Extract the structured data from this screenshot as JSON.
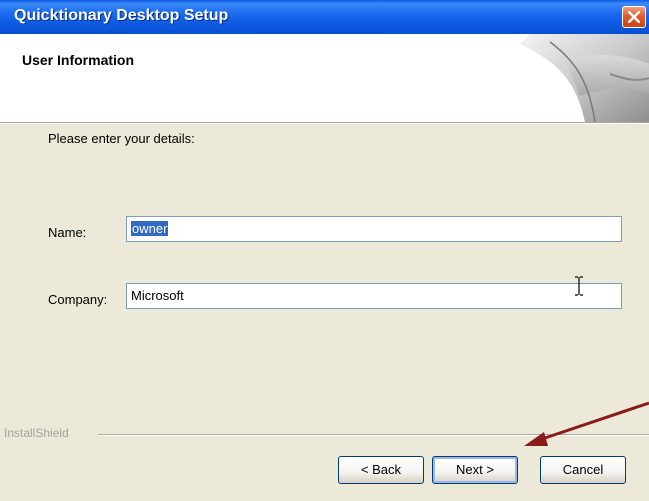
{
  "window": {
    "title": "Quicktionary Desktop Setup"
  },
  "header": {
    "title": "User Information"
  },
  "form": {
    "prompt": "Please enter your details:",
    "name_label": "Name:",
    "name_value": "owner",
    "company_label": "Company:",
    "company_value": "Microsoft"
  },
  "footer": {
    "brand": "InstallShield",
    "back_label": "< Back",
    "next_label": "Next >",
    "cancel_label": "Cancel"
  },
  "colors": {
    "titlebar": "#0a58e8",
    "selection": "#316ac5",
    "arrow": "#8b1a1a",
    "close_button": "#e25b2e"
  }
}
